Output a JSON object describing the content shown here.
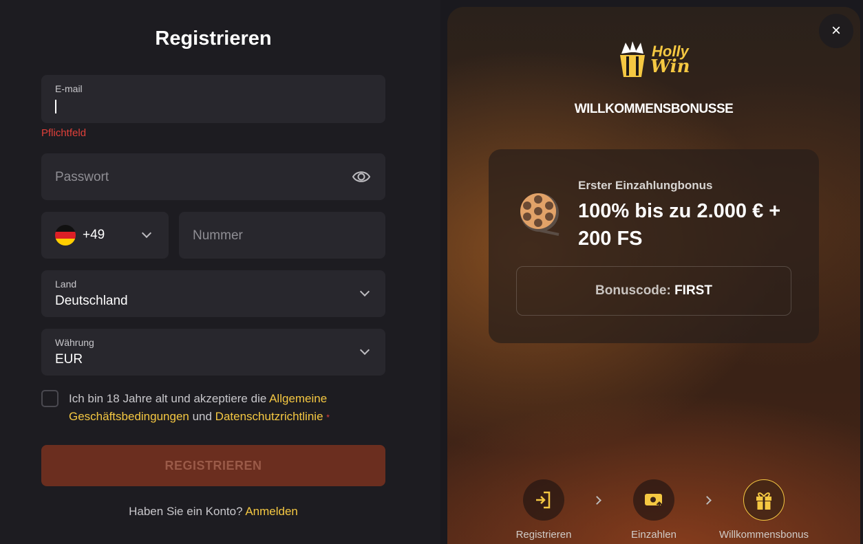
{
  "form": {
    "title": "Registrieren",
    "email_label": "E-mail",
    "email_value": "",
    "email_error": "Pflichtfeld",
    "password_placeholder": "Passwort",
    "phone_code": "+49",
    "phone_placeholder": "Nummer",
    "country_label": "Land",
    "country_value": "Deutschland",
    "currency_label": "Währung",
    "currency_value": "EUR",
    "terms_prefix": "Ich bin 18 Jahre alt und akzeptiere die ",
    "terms_link1": "Allgemeine Geschäftsbedingungen",
    "terms_mid": " und ",
    "terms_link2": "Datenschutzrichtlinie",
    "terms_required": "*",
    "submit_label": "REGISTRIEREN",
    "login_prompt": "Haben Sie ein Konto? ",
    "login_link": "Anmelden"
  },
  "promo": {
    "logo_line1": "Holly",
    "logo_line2": "Win",
    "heading": "WILLKOMMENSBONUSSE",
    "bonus_subtitle": "Erster Einzahlungbonus",
    "bonus_title": "100% bis zu 2.000 € + 200 FS",
    "code_label": "Bonuscode: ",
    "code_value": "FIRST",
    "close_icon": "×",
    "steps": [
      {
        "label": "Registrieren",
        "icon": "login-icon"
      },
      {
        "label": "Einzahlen",
        "icon": "deposit-icon"
      },
      {
        "label": "Willkommensbonus",
        "icon": "gift-icon"
      }
    ]
  },
  "colors": {
    "accent": "#f5c842",
    "error": "#e0403a",
    "button": "#6b2e1f",
    "field_bg": "#28272d"
  }
}
